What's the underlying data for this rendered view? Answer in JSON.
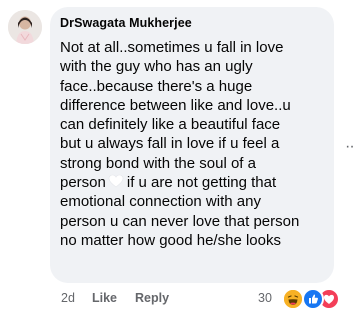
{
  "comment": {
    "author": "DrSwagata Mukherjee",
    "text_lines": [
      "Not at all..sometimes u fall in love",
      "with the guy who has an ugly",
      "face..because there's a huge",
      "difference between like and love..u",
      "can definitely like a beautiful face",
      "but u always fall in love if u feel a",
      "strong bond with the soul of a",
      "person",
      "if u are not getting that",
      "emotional connection with any",
      "person u can never love that person",
      "no matter how good he/she looks"
    ],
    "inline_emoji": "white-heart-icon"
  },
  "actions": {
    "time": "2d",
    "like_label": "Like",
    "reply_label": "Reply"
  },
  "reactions": {
    "count": "30",
    "icons": [
      "haha-icon",
      "like-icon",
      "love-icon"
    ]
  },
  "more_options": "··",
  "colors": {
    "bubble": "#f0f2f5",
    "text": "#050505",
    "secondary": "#65676b",
    "like_blue": "#1877f2",
    "love_red": "#f33e58",
    "haha_yellow": "#f7b125"
  }
}
